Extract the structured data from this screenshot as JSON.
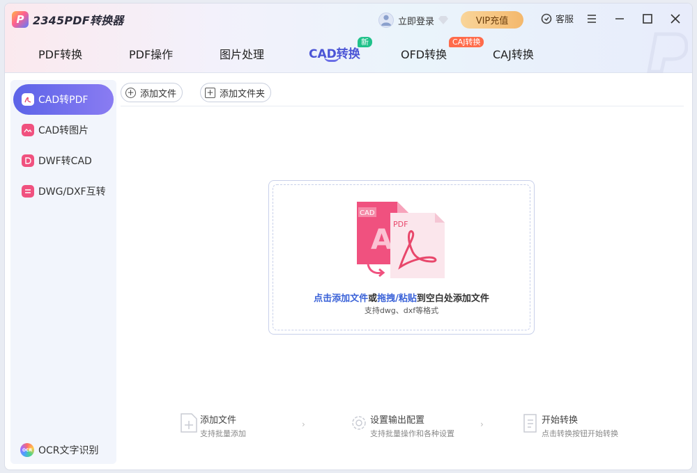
{
  "app": {
    "logo_letter": "P",
    "title": "2345PDF转换器"
  },
  "header": {
    "login_label": "立即登录",
    "vip_label": "VIP充值",
    "service_label": "客服"
  },
  "tabs": [
    {
      "label": "PDF转换"
    },
    {
      "label": "PDF操作"
    },
    {
      "label": "图片处理"
    },
    {
      "label": "CAD转换",
      "badge": "新"
    },
    {
      "label": "OFD转换",
      "badge": "热"
    },
    {
      "label": "CAJ转换"
    }
  ],
  "sidebar": {
    "items": [
      {
        "label": "CAD转PDF",
        "icon": "pdf-icon"
      },
      {
        "label": "CAD转图片",
        "icon": "image-icon"
      },
      {
        "label": "DWF转CAD",
        "icon": "dwf-icon"
      },
      {
        "label": "DWG/DXF互转",
        "icon": "swap-icon"
      }
    ],
    "ocr_label": "OCR文字识别",
    "ocr_icon_text": "OCR"
  },
  "toolbar": {
    "add_file": "添加文件",
    "add_folder": "添加文件夹"
  },
  "dropzone": {
    "cad_label": "CAD",
    "pdf_label": "PDF",
    "text_click_add": "点击添加文件",
    "text_or": "或",
    "text_drag_paste": "拖拽/粘贴",
    "text_rest": "到空白处添加文件",
    "sub": "支持dwg、dxf等格式"
  },
  "steps": [
    {
      "title": "添加文件",
      "desc": "支持批量添加"
    },
    {
      "title": "设置输出配置",
      "desc": "支持批量操作和各种设置"
    },
    {
      "title": "开始转换",
      "desc": "点击转换按钮开始转换"
    }
  ],
  "step_arrow": "›",
  "colors": {
    "accent": "#4b55d6",
    "active_sidebar_start": "#5b63e8",
    "active_sidebar_end": "#8a7cf2",
    "vip_gold": "#f4b86c",
    "badge_new": "#1fc18a",
    "badge_hot": "#ff6b4a",
    "link_blue": "#3a62d8",
    "cad_pink": "#f0517f"
  }
}
